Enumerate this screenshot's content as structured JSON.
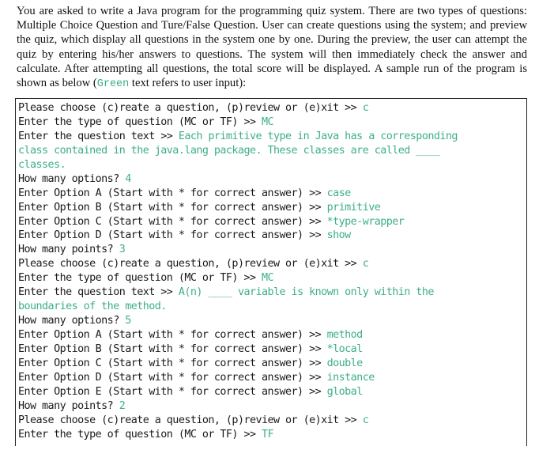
{
  "intro": {
    "text_before": "You are asked to write a Java program for the programming quiz system. There are two types of questions: Multiple Choice Question and Ture/False Question. User can create questions using the system; and preview the quiz, which display all questions in the system one by one. During the preview, the user can attempt the quiz by entering his/her answers to questions. The system will then immediately check the answer and calculate. After attempting all questions, the total score will be displayed. A sample run of the program is shown as below (",
    "green_word": "Green",
    "text_after": " text refers to user input):"
  },
  "colors": {
    "user_input": "#3dae8a",
    "text": "#1a1a1a",
    "border": "#222222"
  },
  "console_lines": [
    {
      "prompt": "Please choose (c)reate a question, (p)review or (e)xit >> ",
      "input": "c"
    },
    {
      "prompt": "Enter the type of question (MC or TF) >> ",
      "input": "MC"
    },
    {
      "prompt": "Enter the question text >> ",
      "input": "Each primitive type in Java has a corresponding"
    },
    {
      "prompt": "",
      "input": "class contained in the java.lang package. These classes are called ____"
    },
    {
      "prompt": "",
      "input": "classes."
    },
    {
      "prompt": "How many options? ",
      "input": "4"
    },
    {
      "prompt": "Enter Option A (Start with * for correct answer) >> ",
      "input": "case"
    },
    {
      "prompt": "Enter Option B (Start with * for correct answer) >> ",
      "input": "primitive"
    },
    {
      "prompt": "Enter Option C (Start with * for correct answer) >> ",
      "input": "*type-wrapper"
    },
    {
      "prompt": "Enter Option D (Start with * for correct answer) >> ",
      "input": "show"
    },
    {
      "prompt": "How many points? ",
      "input": "3"
    },
    {
      "prompt": "Please choose (c)reate a question, (p)review or (e)xit >> ",
      "input": "c"
    },
    {
      "prompt": "Enter the type of question (MC or TF) >> ",
      "input": "MC"
    },
    {
      "prompt": "Enter the question text >> ",
      "input": "A(n) ____ variable is known only within the"
    },
    {
      "prompt": "",
      "input": "boundaries of the method."
    },
    {
      "prompt": "How many options? ",
      "input": "5"
    },
    {
      "prompt": "Enter Option A (Start with * for correct answer) >> ",
      "input": "method"
    },
    {
      "prompt": "Enter Option B (Start with * for correct answer) >> ",
      "input": "*local"
    },
    {
      "prompt": "Enter Option C (Start with * for correct answer) >> ",
      "input": "double"
    },
    {
      "prompt": "Enter Option D (Start with * for correct answer) >> ",
      "input": "instance"
    },
    {
      "prompt": "Enter Option E (Start with * for correct answer) >> ",
      "input": "global"
    },
    {
      "prompt": "How many points? ",
      "input": "2"
    },
    {
      "prompt": "Please choose (c)reate a question, (p)review or (e)xit >> ",
      "input": "c"
    },
    {
      "prompt": "Enter the type of question (MC or TF) >> ",
      "input": "TF"
    }
  ]
}
